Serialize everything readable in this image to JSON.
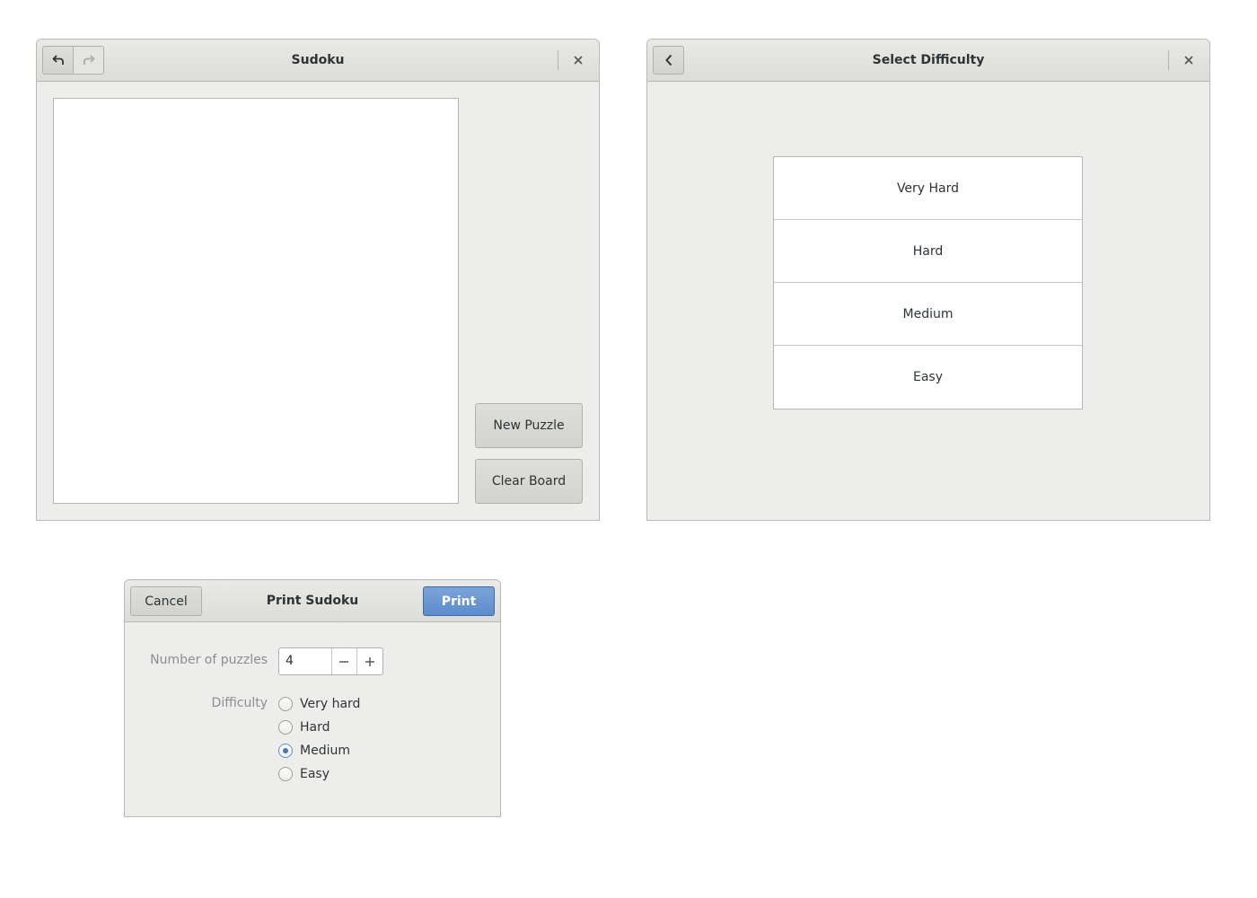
{
  "sudoku_window": {
    "title": "Sudoku",
    "undo_icon": "undo-icon",
    "redo_icon": "redo-icon",
    "close_icon": "close-icon",
    "new_puzzle_label": "New Puzzle",
    "clear_board_label": "Clear Board"
  },
  "difficulty_window": {
    "title": "Select Difficulty",
    "back_icon": "chevron-left-icon",
    "close_icon": "close-icon",
    "options": [
      "Very Hard",
      "Hard",
      "Medium",
      "Easy"
    ]
  },
  "print_dialog": {
    "title": "Print Sudoku",
    "cancel_label": "Cancel",
    "print_label": "Print",
    "number_label": "Number of puzzles",
    "number_value": "4",
    "minus_icon": "minus-icon",
    "plus_icon": "plus-icon",
    "difficulty_label": "Difficulty",
    "difficulty_options": [
      {
        "label": "Very hard",
        "selected": false
      },
      {
        "label": "Hard",
        "selected": false
      },
      {
        "label": "Medium",
        "selected": true
      },
      {
        "label": "Easy",
        "selected": false
      }
    ]
  },
  "colors": {
    "window_bg": "#ededeb",
    "accent": "#5d8ccc",
    "border": "#b9bab5"
  }
}
